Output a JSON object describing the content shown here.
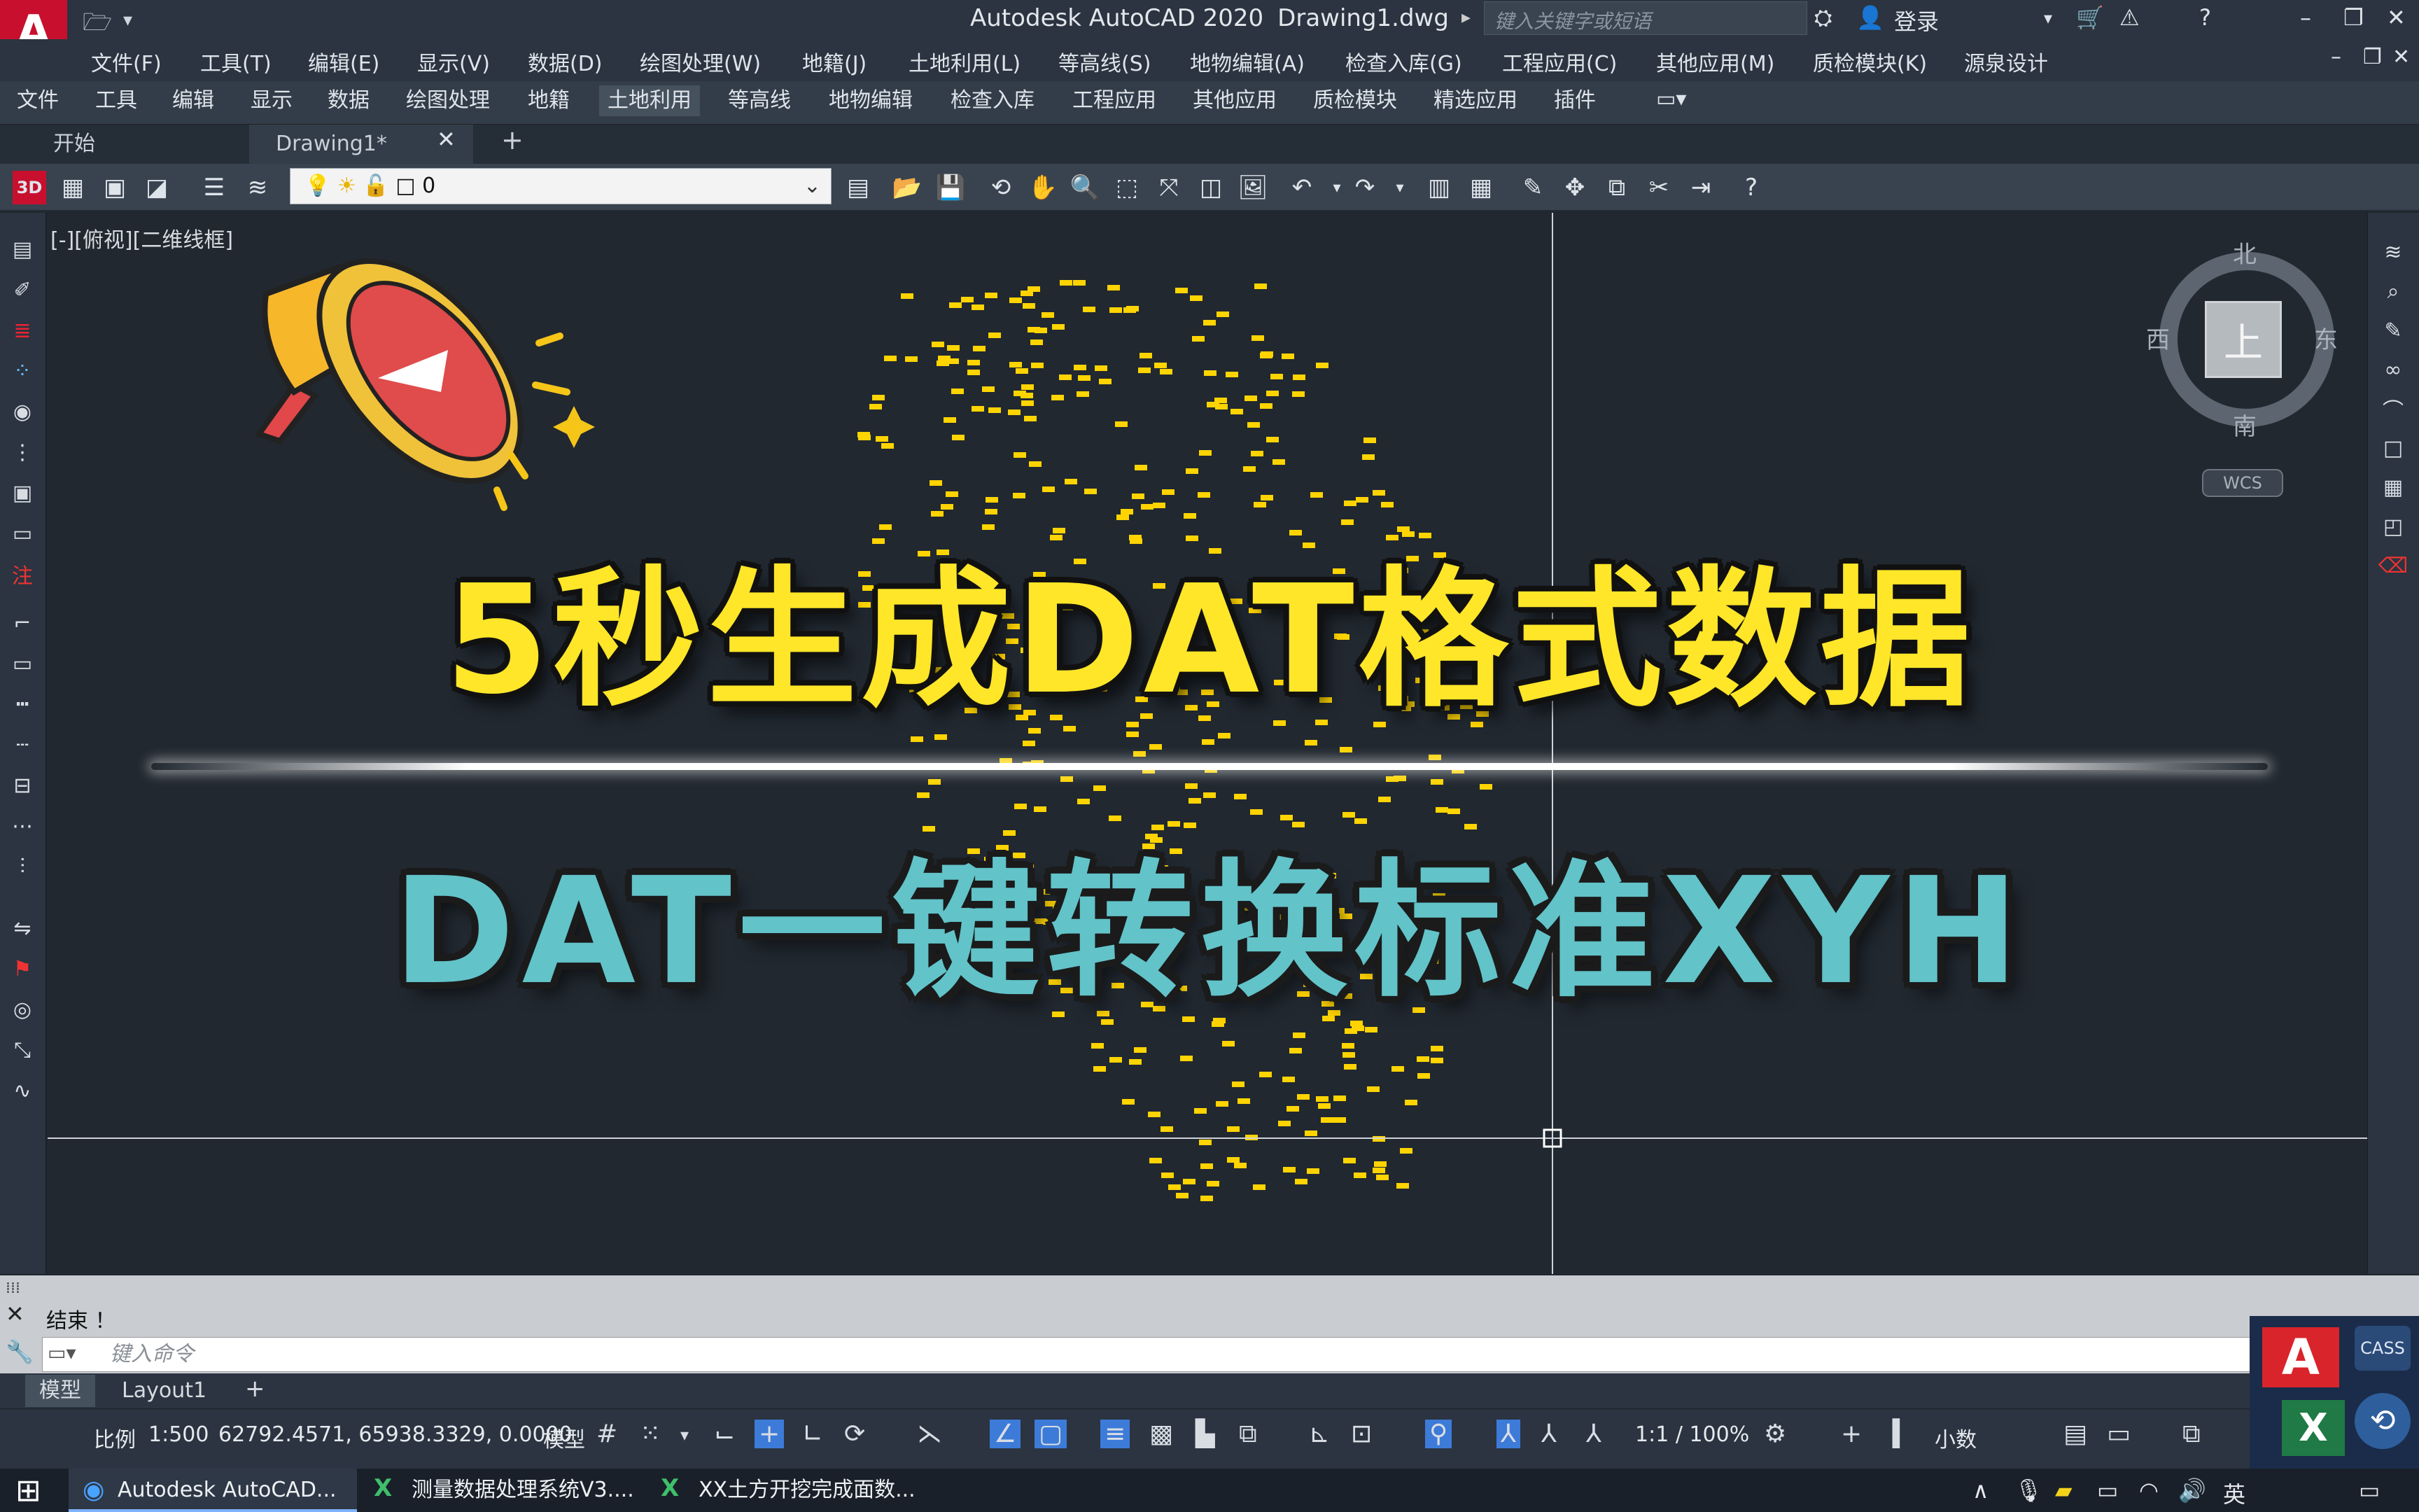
{
  "window": {
    "title": "Autodesk AutoCAD 2020",
    "file": "Drawing1.dwg",
    "search_placeholder": "键入关键字或短语",
    "login": "登录"
  },
  "menu": [
    "文件(F)",
    "工具(T)",
    "编辑(E)",
    "显示(V)",
    "数据(D)",
    "绘图处理(W)",
    "地籍(J)",
    "土地利用(L)",
    "等高线(S)",
    "地物编辑(A)",
    "检查入库(G)",
    "工程应用(C)",
    "其他应用(M)",
    "质检模块(K)",
    "源泉设计"
  ],
  "ribbon_tabs": [
    "文件",
    "工具",
    "编辑",
    "显示",
    "数据",
    "绘图处理",
    "地籍",
    "土地利用",
    "等高线",
    "地物编辑",
    "检查入库",
    "工程应用",
    "其他应用",
    "质检模块",
    "精选应用",
    "插件"
  ],
  "ribbon_active": "土地利用",
  "doc_tabs": {
    "start": "开始",
    "drawing": "Drawing1*",
    "close": "✕",
    "add": "+"
  },
  "toolbar": {
    "layer_value": "0"
  },
  "viewport": {
    "label": "[-][俯视][二维线框]"
  },
  "navcube": {
    "north": "北",
    "south": "南",
    "east": "东",
    "west": "西",
    "top": "上",
    "wcs": "WCS"
  },
  "overlay": {
    "headline": "5秒生成DAT格式数据",
    "subheadline": "DAT一键转换标准XYH"
  },
  "command": {
    "history": "结束 ！",
    "placeholder": "键入命令"
  },
  "layout_tabs": [
    "模型",
    "Layout1"
  ],
  "statusbar": {
    "scale_label": "比例",
    "scale_value": "1:500",
    "coords": "62792.4571, 65938.3329, 0.0000",
    "model": "模型",
    "zoom": "1:1 / 100%",
    "units": "小数"
  },
  "taskbar": {
    "items": [
      "Autodesk AutoCAD...",
      "测量数据处理系统V3....",
      "XX土方开挖完成面数..."
    ],
    "ime": "英"
  },
  "colors": {
    "accent_yellow": "#ffe628",
    "accent_teal": "#62c3c9",
    "points": "#ffd400"
  }
}
